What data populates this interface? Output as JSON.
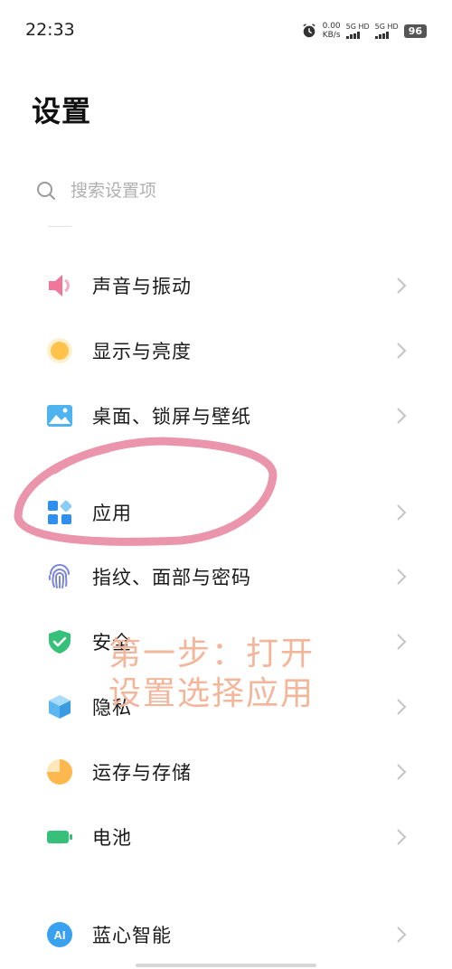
{
  "status_bar": {
    "time": "22:33",
    "net_speed_value": "0.00",
    "net_speed_unit": "KB/s",
    "sim1": "5G HD",
    "sim2": "5G HD",
    "battery": "96"
  },
  "page": {
    "title": "设置"
  },
  "search": {
    "placeholder": "搜索设置项"
  },
  "items": [
    {
      "label": "声音与振动",
      "icon": "speaker-icon",
      "color": "#f2769a"
    },
    {
      "label": "显示与亮度",
      "icon": "sun-icon",
      "color": "#ffc24a"
    },
    {
      "label": "桌面、锁屏与壁纸",
      "icon": "wallpaper-icon",
      "color": "#4fb3f0"
    },
    {
      "label": "应用",
      "icon": "apps-grid-icon",
      "color": "#2f8ff0"
    },
    {
      "label": "指纹、面部与密码",
      "icon": "fingerprint-icon",
      "color": "#7b86d9"
    },
    {
      "label": "安全",
      "icon": "shield-icon",
      "color": "#37c07a"
    },
    {
      "label": "隐私",
      "icon": "cube-icon",
      "color": "#5cb6f0"
    },
    {
      "label": "运存与存储",
      "icon": "pie-icon",
      "color": "#ffb84d"
    },
    {
      "label": "电池",
      "icon": "battery-icon",
      "color": "#37c07a"
    },
    {
      "label": "蓝心智能",
      "icon": "ai-icon",
      "color": "#3aa0f0"
    }
  ],
  "annotation": {
    "line1": "第一步：打开",
    "line2": "设置选择应用",
    "color": "#f4b69a",
    "circle_color": "#e88aa2"
  }
}
